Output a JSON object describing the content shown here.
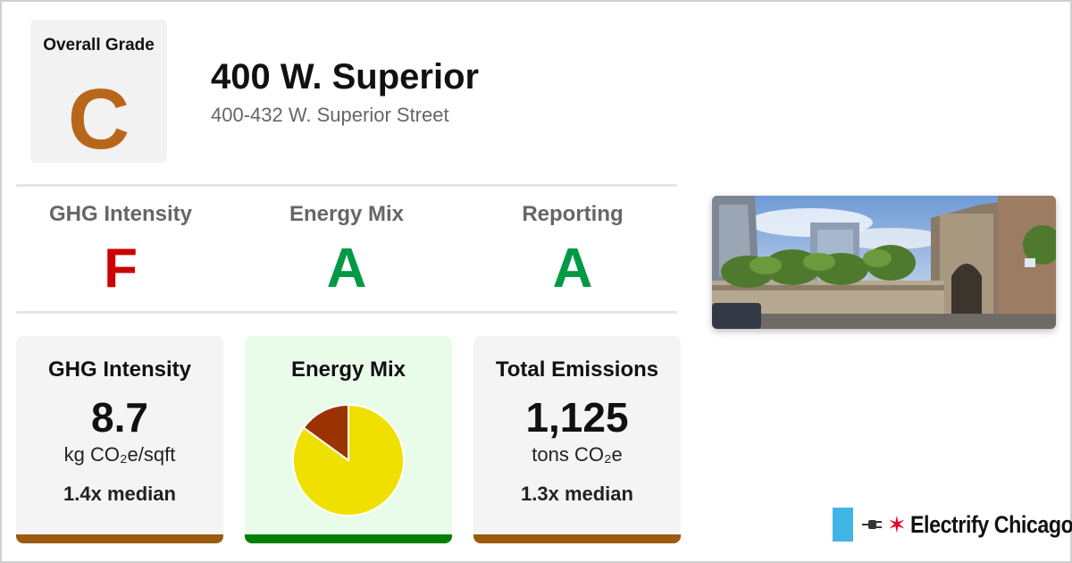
{
  "overall": {
    "label": "Overall Grade",
    "grade": "C",
    "color": "#b8661b"
  },
  "building": {
    "name": "400 W. Superior",
    "address": "400-432 W. Superior Street"
  },
  "grades": [
    {
      "label": "GHG Intensity",
      "grade": "F",
      "color": "#cc0000"
    },
    {
      "label": "Energy Mix",
      "grade": "A",
      "color": "#009944"
    },
    {
      "label": "Reporting",
      "grade": "A",
      "color": "#009944"
    }
  ],
  "cards": {
    "ghg": {
      "title": "GHG Intensity",
      "value": "8.7",
      "unit": "kg CO₂e/sqft",
      "median": "1.4x median",
      "bar_color": "#9a5a10"
    },
    "mix": {
      "title": "Energy Mix",
      "bar_color": "#008000"
    },
    "emissions": {
      "title": "Total Emissions",
      "value": "1,125",
      "unit": "tons CO₂e",
      "median": "1.3x median",
      "bar_color": "#9a5a10"
    }
  },
  "chart_data": {
    "type": "pie",
    "title": "",
    "slices": [
      {
        "value": 0.85,
        "color": "#f0e000"
      },
      {
        "value": 0.15,
        "color": "#9a3300"
      }
    ]
  },
  "brand": {
    "name": "Electrify Chicago"
  },
  "icons": {
    "plug": "plug-icon",
    "star": "red-star-icon",
    "flag": "chicago-flag-bar-icon"
  }
}
